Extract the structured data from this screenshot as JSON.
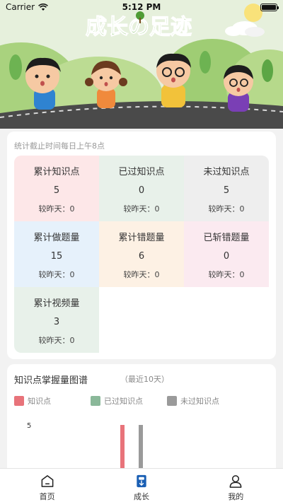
{
  "status_bar": {
    "carrier": "Carrier",
    "time": "5:12 PM"
  },
  "banner": {
    "title": "成长の足迹"
  },
  "stats": {
    "note": "统计截止时间每日上午8点",
    "items": [
      {
        "title": "累计知识点",
        "value": "5",
        "diff": "较昨天：0",
        "color": "#fde7e8"
      },
      {
        "title": "已过知识点",
        "value": "0",
        "diff": "较昨天：0",
        "color": "#e8f1ea"
      },
      {
        "title": "未过知识点",
        "value": "5",
        "diff": "较昨天：0",
        "color": "#eeeeee"
      },
      {
        "title": "累计做题量",
        "value": "15",
        "diff": "较昨天：0",
        "color": "#e6f1fb"
      },
      {
        "title": "累计错题量",
        "value": "6",
        "diff": "较昨天：0",
        "color": "#fdf1e4"
      },
      {
        "title": "已斩错题量",
        "value": "0",
        "diff": "较昨天：0",
        "color": "#fbeaf0"
      },
      {
        "title": "累计视频量",
        "value": "3",
        "diff": "较昨天：0",
        "color": "#e8f1ea"
      }
    ]
  },
  "chart_section": {
    "title": "知识点掌握量图谱",
    "subtitle": "（最近10天）"
  },
  "chart_data": {
    "type": "bar",
    "title": "知识点掌握量图谱",
    "subtitle": "（最近10天）",
    "series": [
      {
        "name": "知识点",
        "color": "#e8737a",
        "values": [
          5
        ]
      },
      {
        "name": "已过知识点",
        "color": "#8ab899",
        "values": [
          0
        ]
      },
      {
        "name": "未过知识点",
        "color": "#9a9a9a",
        "values": [
          5
        ]
      }
    ],
    "y_tick_labels": [
      "5"
    ],
    "ylim": [
      0,
      5
    ],
    "legend_position": "top-left"
  },
  "tabbar": {
    "tabs": [
      {
        "label": "首页",
        "icon": "home-icon"
      },
      {
        "label": "成长",
        "icon": "growth-icon",
        "active": true
      },
      {
        "label": "我的",
        "icon": "profile-icon"
      }
    ],
    "accent_color": "#1a5fb4"
  }
}
